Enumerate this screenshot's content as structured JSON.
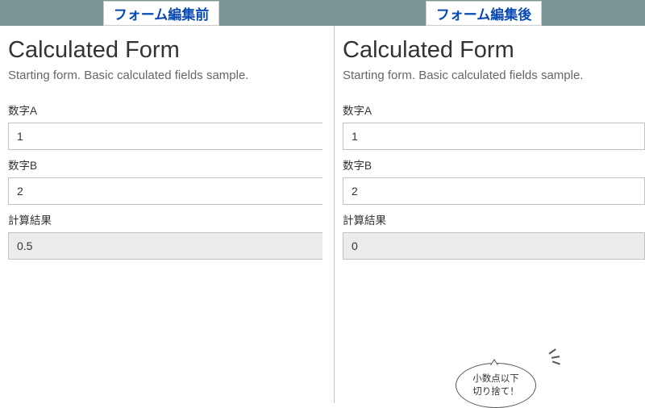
{
  "header": {
    "left": "フォーム編集前",
    "right": "フォーム編集後"
  },
  "form": {
    "title": "Calculated Form",
    "subtitle": "Starting form. Basic calculated fields sample.",
    "fieldA": {
      "label": "数字A",
      "value_left": "1",
      "value_right": "1"
    },
    "fieldB": {
      "label": "数字B",
      "value_left": "2",
      "value_right": "2"
    },
    "result": {
      "label": "計算結果",
      "value_left": "0.5",
      "value_right": "0"
    }
  },
  "bubble": {
    "line1": "小数点以下",
    "line2": "切り捨て！"
  }
}
